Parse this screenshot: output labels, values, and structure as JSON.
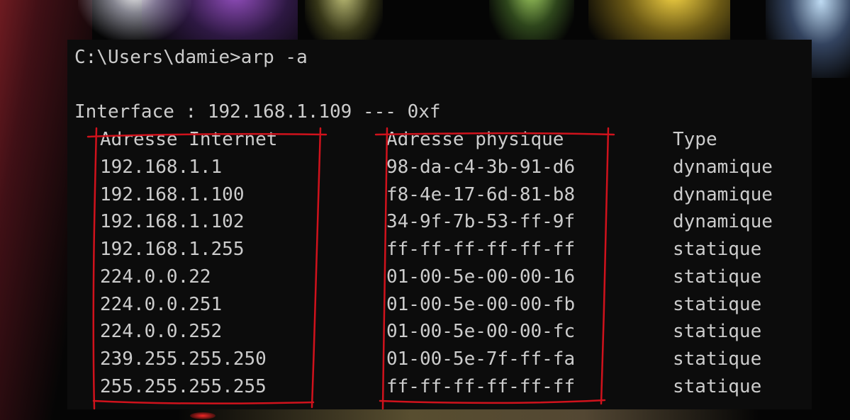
{
  "terminal": {
    "prompt": "C:\\Users\\damie>arp -a",
    "interface_line": "Interface : 192.168.1.109 --- 0xf",
    "headers": {
      "internet_address": "Adresse Internet",
      "physical_address": "Adresse physique",
      "type": "Type"
    },
    "entries": [
      {
        "ip": "192.168.1.1",
        "mac": "98-da-c4-3b-91-d6",
        "type": "dynamique"
      },
      {
        "ip": "192.168.1.100",
        "mac": "f8-4e-17-6d-81-b8",
        "type": "dynamique"
      },
      {
        "ip": "192.168.1.102",
        "mac": "34-9f-7b-53-ff-9f",
        "type": "dynamique"
      },
      {
        "ip": "192.168.1.255",
        "mac": "ff-ff-ff-ff-ff-ff",
        "type": "statique"
      },
      {
        "ip": "224.0.0.22",
        "mac": "01-00-5e-00-00-16",
        "type": "statique"
      },
      {
        "ip": "224.0.0.251",
        "mac": "01-00-5e-00-00-fb",
        "type": "statique"
      },
      {
        "ip": "224.0.0.252",
        "mac": "01-00-5e-00-00-fc",
        "type": "statique"
      },
      {
        "ip": "239.255.255.250",
        "mac": "01-00-5e-7f-ff-fa",
        "type": "statique"
      },
      {
        "ip": "255.255.255.255",
        "mac": "ff-ff-ff-ff-ff-ff",
        "type": "statique"
      }
    ]
  },
  "colors": {
    "terminal_bg": "#0c0c0c",
    "terminal_text": "#cccccc",
    "annotation": "#d0121c"
  }
}
